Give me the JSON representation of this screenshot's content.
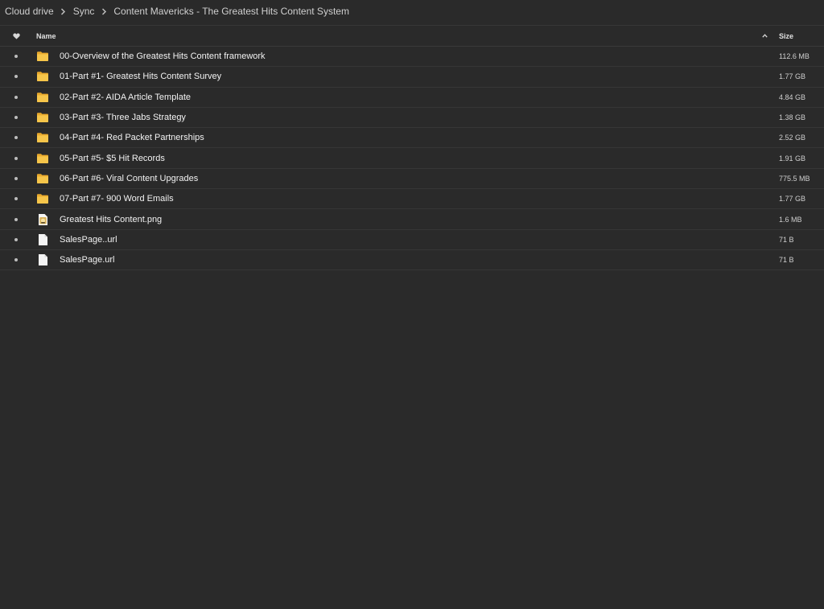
{
  "breadcrumb": {
    "items": [
      {
        "label": "Cloud drive"
      },
      {
        "label": "Sync"
      },
      {
        "label": "Content Mavericks - The Greatest Hits Content System"
      }
    ]
  },
  "table": {
    "header": {
      "favorite_icon": "heart-icon",
      "name_label": "Name",
      "sort_icon": "chevron-up-icon",
      "size_label": "Size"
    },
    "rows": [
      {
        "type": "folder",
        "icon": "folder-icon",
        "name": "00-Overview of the Greatest Hits Content framework",
        "size": "112.6 MB"
      },
      {
        "type": "folder",
        "icon": "folder-icon",
        "name": "01-Part #1- Greatest Hits Content Survey",
        "size": "1.77 GB"
      },
      {
        "type": "folder",
        "icon": "folder-icon",
        "name": "02-Part #2- AIDA Article Template",
        "size": "4.84 GB"
      },
      {
        "type": "folder",
        "icon": "folder-icon",
        "name": "03-Part #3- Three Jabs Strategy",
        "size": "1.38 GB"
      },
      {
        "type": "folder",
        "icon": "folder-icon",
        "name": "04-Part #4- Red Packet Partnerships",
        "size": "2.52 GB"
      },
      {
        "type": "folder",
        "icon": "folder-icon",
        "name": "05-Part #5- $5 Hit Records",
        "size": "1.91 GB"
      },
      {
        "type": "folder",
        "icon": "folder-icon",
        "name": "06-Part #6- Viral Content Upgrades",
        "size": "775.5 MB"
      },
      {
        "type": "folder",
        "icon": "folder-icon",
        "name": "07-Part #7- 900 Word Emails",
        "size": "1.77 GB"
      },
      {
        "type": "image",
        "icon": "image-file-icon",
        "name": "Greatest Hits Content.png",
        "size": "1.6 MB"
      },
      {
        "type": "file",
        "icon": "document-icon",
        "name": "SalesPage..url",
        "size": "71 B"
      },
      {
        "type": "file",
        "icon": "document-icon",
        "name": "SalesPage.url",
        "size": "71 B"
      }
    ]
  },
  "colors": {
    "background": "#2a2a2a",
    "folder": "#f5c244",
    "text": "#f2f2f2",
    "muted_text": "#cfcfcf"
  }
}
